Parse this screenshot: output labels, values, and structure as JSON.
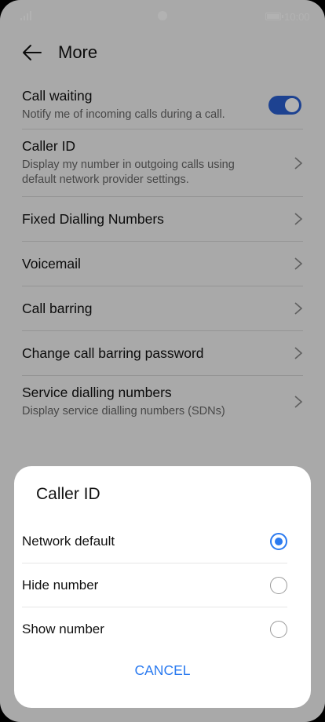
{
  "status_bar": {
    "time": "10:00"
  },
  "header": {
    "title": "More"
  },
  "settings": [
    {
      "title": "Call waiting",
      "subtitle": "Notify me of incoming calls during a call."
    },
    {
      "title": "Caller ID",
      "subtitle": "Display my number in outgoing calls using default network provider settings."
    },
    {
      "title": "Fixed Dialling Numbers"
    },
    {
      "title": "Voicemail"
    },
    {
      "title": "Call barring"
    },
    {
      "title": "Change call barring password"
    },
    {
      "title": "Service dialling numbers",
      "subtitle": "Display service dialling numbers (SDNs)"
    }
  ],
  "call_waiting_toggle_on": true,
  "dialog": {
    "title": "Caller ID",
    "options": [
      "Network default",
      "Hide number",
      "Show number"
    ],
    "selected_option": "Network default",
    "cancel_label": "CANCEL"
  },
  "colors": {
    "accent": "#2a7af0",
    "toggle": "#2a5fd0"
  },
  "icons": {
    "back": "arrow-left-icon",
    "chevron": "chevron-right-icon"
  }
}
